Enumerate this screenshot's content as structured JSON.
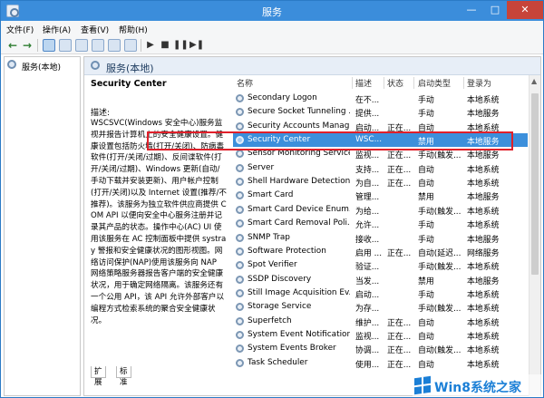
{
  "window": {
    "title": "服务"
  },
  "menu": [
    "文件(F)",
    "操作(A)",
    "查看(V)",
    "帮助(H)"
  ],
  "tree": {
    "root": "服务(本地)"
  },
  "main": {
    "header": "服务(本地)"
  },
  "description": {
    "title": "Security Center",
    "label": "描述:",
    "body": "WSCSVC(Windows 安全中心)服务监视并报告计算机上的安全健康设置。健康设置包括防火墙(打开/关闭)、防病毒软件(打开/关闭/过期)、反间谍软件(打开/关闭/过期)、Windows 更新(自动/手动下载并安装更新)、用户帐户控制(打开/关闭)以及 Internet 设置(推荐/不推荐)。该服务为独立软件供应商提供 COM API 以便向安全中心服务注册并记录其产品的状态。操作中心(AC) UI 使用该服务在 AC 控制面板中提供 systray 警报和安全健康状况的图形视图。网络访问保护(NAP)使用该服务向 NAP 网络策略服务器报告客户端的安全健康状况，用于确定网络隔离。该服务还有一个公用 API，该 API 允许外部客户以编程方式检索系统的聚合安全健康状况。"
  },
  "tabs": [
    "扩展",
    "标准"
  ],
  "columns": [
    "名称",
    "描述",
    "状态",
    "启动类型",
    "登录为"
  ],
  "rows": [
    {
      "name": "Secondary Logon",
      "desc": "在不...",
      "status": "",
      "startup": "手动",
      "logon": "本地系统"
    },
    {
      "name": "Secure Socket Tunneling ...",
      "desc": "提供...",
      "status": "",
      "startup": "手动",
      "logon": "本地服务"
    },
    {
      "name": "Security Accounts Manag...",
      "desc": "启动...",
      "status": "正在...",
      "startup": "自动",
      "logon": "本地系统"
    },
    {
      "name": "Security Center",
      "desc": "WSC...",
      "status": "",
      "startup": "禁用",
      "logon": "本地服务",
      "selected": true
    },
    {
      "name": "Sensor Monitoring Service",
      "desc": "监视...",
      "status": "正在...",
      "startup": "手动(触发...",
      "logon": "本地服务"
    },
    {
      "name": "Server",
      "desc": "支持...",
      "status": "正在...",
      "startup": "自动",
      "logon": "本地系统"
    },
    {
      "name": "Shell Hardware Detection",
      "desc": "为自...",
      "status": "正在...",
      "startup": "自动",
      "logon": "本地系统"
    },
    {
      "name": "Smart Card",
      "desc": "管理...",
      "status": "",
      "startup": "禁用",
      "logon": "本地服务"
    },
    {
      "name": "Smart Card Device Enum...",
      "desc": "为给...",
      "status": "",
      "startup": "手动(触发...",
      "logon": "本地系统"
    },
    {
      "name": "Smart Card Removal Poli...",
      "desc": "允许...",
      "status": "",
      "startup": "手动",
      "logon": "本地系统"
    },
    {
      "name": "SNMP Trap",
      "desc": "接收...",
      "status": "",
      "startup": "手动",
      "logon": "本地服务"
    },
    {
      "name": "Software Protection",
      "desc": "启用 ...",
      "status": "正在...",
      "startup": "自动(延迟...",
      "logon": "网络服务"
    },
    {
      "name": "Spot Verifier",
      "desc": "验证...",
      "status": "",
      "startup": "手动(触发...",
      "logon": "本地系统"
    },
    {
      "name": "SSDP Discovery",
      "desc": "当发...",
      "status": "",
      "startup": "禁用",
      "logon": "本地服务"
    },
    {
      "name": "Still Image Acquisition Ev...",
      "desc": "启动...",
      "status": "",
      "startup": "手动",
      "logon": "本地系统"
    },
    {
      "name": "Storage Service",
      "desc": "为存...",
      "status": "",
      "startup": "手动(触发...",
      "logon": "本地系统"
    },
    {
      "name": "Superfetch",
      "desc": "维护...",
      "status": "正在...",
      "startup": "自动",
      "logon": "本地系统"
    },
    {
      "name": "System Event Notification...",
      "desc": "监视...",
      "status": "正在...",
      "startup": "自动",
      "logon": "本地系统"
    },
    {
      "name": "System Events Broker",
      "desc": "协调...",
      "status": "正在...",
      "startup": "自动(触发...",
      "logon": "本地系统"
    },
    {
      "name": "Task Scheduler",
      "desc": "使用...",
      "status": "正在...",
      "startup": "自动",
      "logon": "本地系统"
    }
  ],
  "watermark": {
    "text": "Win8系统之家"
  },
  "colors": {
    "titlebar": "#3b8ddb",
    "selection": "#3c8fdb",
    "highlight_border": "#e0202a"
  }
}
